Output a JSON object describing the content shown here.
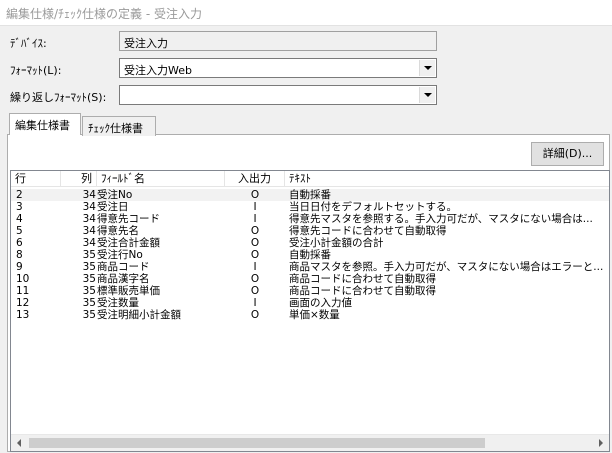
{
  "window": {
    "title": "編集仕様/ﾁｪｯｸ仕様の定義 - 受注入力"
  },
  "form": {
    "device_label": "ﾃﾞﾊﾞｲｽ:",
    "device_value": "受注入力",
    "format_label": "ﾌｫｰﾏｯﾄ(L):",
    "format_value": "受注入力Web",
    "repeat_label": "繰り返しﾌｫｰﾏｯﾄ(S):",
    "repeat_value": ""
  },
  "tabs": [
    {
      "label": "編集仕様書",
      "active": true
    },
    {
      "label": "ﾁｪｯｸ仕様書",
      "active": false
    }
  ],
  "detail_button": {
    "label": "詳細(D)..."
  },
  "table": {
    "columns": [
      "行",
      "列",
      "ﾌｨｰﾙﾄﾞ名",
      "入出力",
      "ﾃｷｽﾄ"
    ],
    "rows": [
      {
        "row": "2",
        "col": "34",
        "field": "受注No",
        "io": "O",
        "text": "自動採番"
      },
      {
        "row": "3",
        "col": "34",
        "field": "受注日",
        "io": "I",
        "text": "当日日付をデフォルトセットする。"
      },
      {
        "row": "4",
        "col": "34",
        "field": "得意先コード",
        "io": "I",
        "text": "得意先マスタを参照する。手入力可だが、マスタにない場合は..."
      },
      {
        "row": "5",
        "col": "34",
        "field": "得意先名",
        "io": "O",
        "text": "得意先コードに合わせて自動取得"
      },
      {
        "row": "6",
        "col": "34",
        "field": "受注合計金額",
        "io": "O",
        "text": "受注小計金額の合計"
      },
      {
        "row": "8",
        "col": "35",
        "field": "受注行No",
        "io": "O",
        "text": "自動採番"
      },
      {
        "row": "9",
        "col": "35",
        "field": "商品コード",
        "io": "I",
        "text": "商品マスタを参照。手入力可だが、マスタにない場合はエラーと..."
      },
      {
        "row": "10",
        "col": "35",
        "field": "商品漢字名",
        "io": "O",
        "text": "商品コードに合わせて自動取得"
      },
      {
        "row": "11",
        "col": "35",
        "field": "標準販売単価",
        "io": "O",
        "text": "商品コードに合わせて自動取得"
      },
      {
        "row": "12",
        "col": "35",
        "field": "受注数量",
        "io": "I",
        "text": "画面の入力値"
      },
      {
        "row": "13",
        "col": "35",
        "field": "受注明細小計金額",
        "io": "O",
        "text": "単価×数量"
      }
    ]
  },
  "scrollbar": {
    "left_icon": "arrow-left-icon",
    "right_icon": "arrow-right-icon"
  }
}
